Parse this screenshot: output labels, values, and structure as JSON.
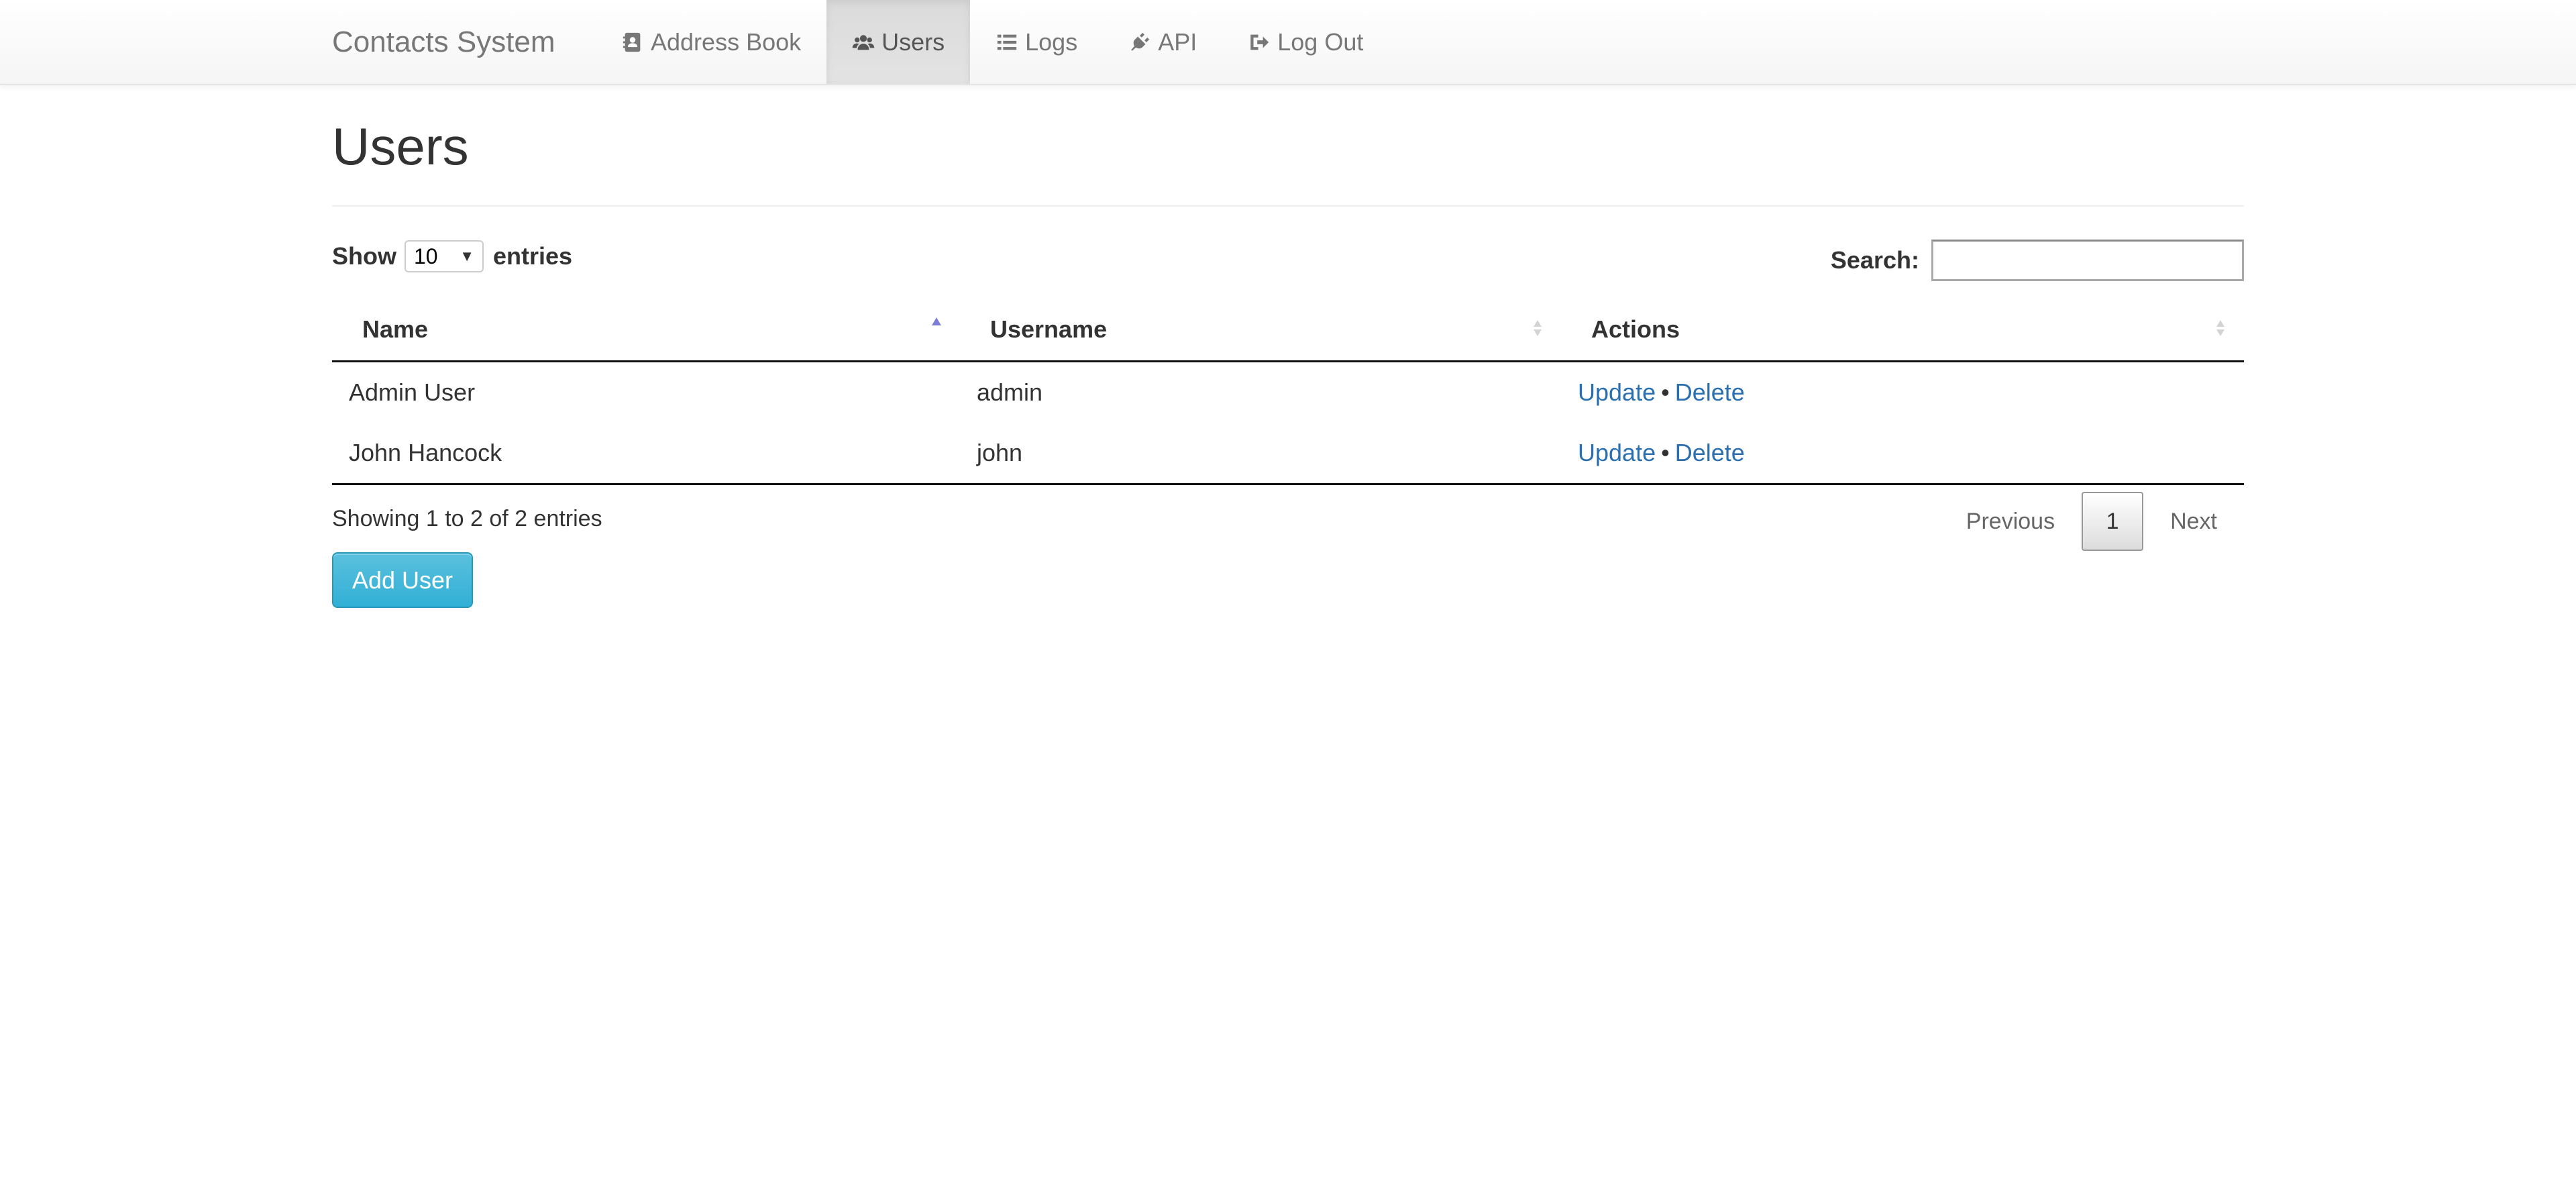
{
  "navbar": {
    "brand": "Contacts System",
    "items": [
      {
        "label": "Address Book",
        "icon": "address-book-icon",
        "active": false
      },
      {
        "label": "Users",
        "icon": "users-icon",
        "active": true
      },
      {
        "label": "Logs",
        "icon": "list-icon",
        "active": false
      },
      {
        "label": "API",
        "icon": "plug-icon",
        "active": false
      },
      {
        "label": "Log Out",
        "icon": "sign-out-icon",
        "active": false
      }
    ]
  },
  "page": {
    "title": "Users"
  },
  "length": {
    "show_label": "Show",
    "value": "10",
    "entries_label": "entries"
  },
  "search": {
    "label": "Search:",
    "value": ""
  },
  "table": {
    "columns": [
      "Name",
      "Username",
      "Actions"
    ],
    "rows": [
      {
        "name": "Admin User",
        "username": "admin",
        "update": "Update",
        "separator": "•",
        "delete": "Delete"
      },
      {
        "name": "John Hancock",
        "username": "john",
        "update": "Update",
        "separator": "•",
        "delete": "Delete"
      }
    ]
  },
  "footer": {
    "info": "Showing 1 to 2 of 2 entries",
    "previous": "Previous",
    "current_page": "1",
    "next": "Next"
  },
  "add_button": "Add User",
  "colors": {
    "link": "#2a6fb0",
    "button": "#31b0d5",
    "sort_active": "#7b7fd6"
  }
}
